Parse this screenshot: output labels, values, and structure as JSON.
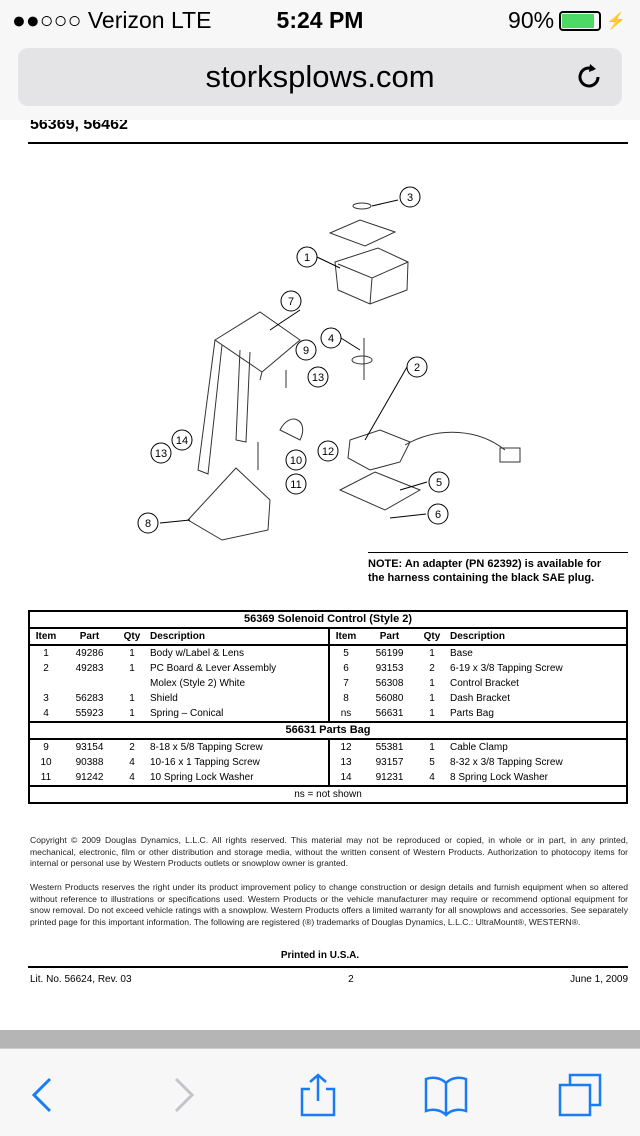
{
  "status_bar": {
    "carrier": "●●○○○ Verizon  LTE",
    "time": "5:24 PM",
    "battery": "90%",
    "battery_level": 0.9,
    "battery_color": "#4cd964"
  },
  "browser": {
    "url": "storksplows.com",
    "icons": [
      "reload-icon",
      "back-icon",
      "forward-icon",
      "share-icon",
      "bookmarks-icon",
      "tabs-icon"
    ],
    "accent": "#1a7cf5"
  },
  "document": {
    "header": "56369, 56462",
    "callouts": [
      "3",
      "1",
      "7",
      "4",
      "9",
      "2",
      "13",
      "14",
      "13",
      "12",
      "10",
      "11",
      "5",
      "6",
      "8"
    ],
    "note": [
      "NOTE: An adapter (PN 62392) is available for",
      "the harness containing the black SAE plug."
    ],
    "table": {
      "title": "56369  Solenoid Control (Style 2)",
      "columns": [
        "Item",
        "Part",
        "Qty",
        "Description"
      ],
      "rows": [
        [
          [
            "1",
            "49286",
            "1",
            "Body w/Label & Lens"
          ],
          [
            "5",
            "56199",
            "1",
            "Base"
          ]
        ],
        [
          [
            "2",
            "49283",
            "1",
            "PC Board & Lever Assembly"
          ],
          [
            "6",
            "93153",
            "2",
            "6-19 x 3/8 Tapping Screw"
          ]
        ],
        [
          [
            "",
            "",
            "",
            "Molex (Style 2) White"
          ],
          [
            "7",
            "56308",
            "1",
            "Control Bracket"
          ]
        ],
        [
          [
            "3",
            "56283",
            "1",
            "Shield"
          ],
          [
            "8",
            "56080",
            "1",
            "Dash Bracket"
          ]
        ],
        [
          [
            "4",
            "55923",
            "1",
            "Spring – Conical"
          ],
          [
            "ns",
            "56631",
            "1",
            "Parts Bag"
          ]
        ]
      ],
      "bag_title": "56631  Parts Bag",
      "bag_rows": [
        [
          [
            "9",
            "93154",
            "2",
            "8-18 x 5/8 Tapping Screw"
          ],
          [
            "12",
            "55381",
            "1",
            "Cable Clamp"
          ]
        ],
        [
          [
            "10",
            "90388",
            "4",
            "10-16 x 1 Tapping Screw"
          ],
          [
            "13",
            "93157",
            "5",
            "8-32 x 3/8 Tapping Screw"
          ]
        ],
        [
          [
            "11",
            "91242",
            "4",
            "10 Spring Lock Washer"
          ],
          [
            "14",
            "91231",
            "4",
            "8 Spring Lock Washer"
          ]
        ]
      ],
      "footnote": "ns = not shown"
    },
    "copyright": "Copyright © 2009 Douglas Dynamics, L.L.C. All rights reserved. This material may not be reproduced or copied, in whole or in part, in any printed, mechanical, electronic, film or other distribution and storage media, without the written consent of Western Products. Authorization to photocopy items for internal or personal use by Western Products outlets or snowplow owner is granted.",
    "disclaimer": "Western Products reserves the right under its product improvement policy to change construction or design details and furnish equipment when so altered without reference to illustrations or specifications used. Western Products or the vehicle manufacturer may require or recommend optional equipment for snow removal. Do not exceed vehicle ratings with a snowplow. Western Products offers a limited warranty for all snowplows and accessories. See separately printed page for this important information. The following are registered (®) trademarks of Douglas Dynamics, L.L.C.: UltraMount®, WESTERN®.",
    "printed": "Printed in U.S.A.",
    "lit_no": "Lit. No. 56624, Rev. 03",
    "page": "2",
    "date": "June 1, 2009"
  }
}
